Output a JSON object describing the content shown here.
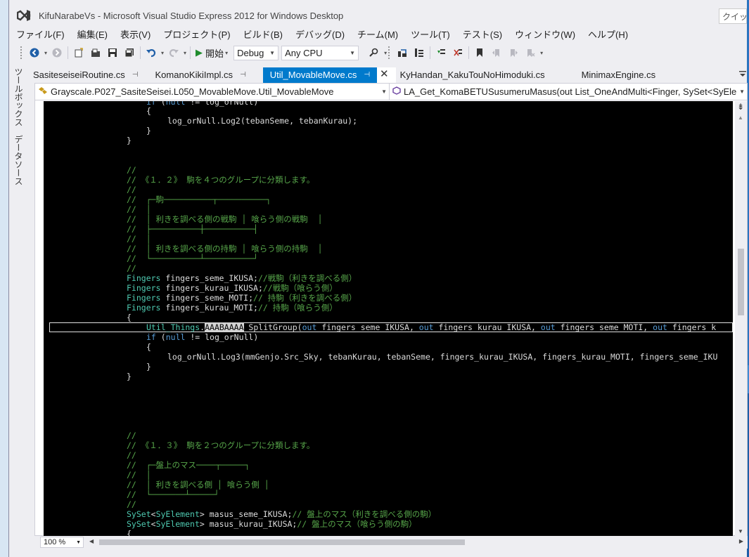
{
  "window": {
    "title": "KifuNarabeVs - Microsoft Visual Studio Express 2012 for Windows Desktop",
    "quick_launch": "クイッ"
  },
  "menu": [
    "ファイル(F)",
    "編集(E)",
    "表示(V)",
    "プロジェクト(P)",
    "ビルド(B)",
    "デバッグ(D)",
    "チーム(M)",
    "ツール(T)",
    "テスト(S)",
    "ウィンドウ(W)",
    "ヘルプ(H)"
  ],
  "toolbar": {
    "start_label": "開始",
    "config": "Debug",
    "platform": "Any CPU"
  },
  "tabs": [
    {
      "label": "SasiteseiseiRoutine.cs"
    },
    {
      "label": "KomanoKikiImpl.cs"
    },
    {
      "label": "Util_MovableMove.cs"
    },
    {
      "label": "KyHandan_KakuTouNoHimoduki.cs"
    },
    {
      "label": "MinimaxEngine.cs"
    }
  ],
  "sidebar": {
    "toolbox": "ツールボックス",
    "datasource": "データソース"
  },
  "navbar": {
    "type_path": "Grayscale.P027_SasiteSeisei.L050_MovableMove.Util_MovableMove",
    "member": "LA_Get_KomaBETUSusumeruMasus(out List_OneAndMulti<Finger, SySet<SyEle"
  },
  "code": {
    "l0": "if (null != log_orNull)",
    "l1": "{",
    "l2": "log_orNull.Log2(tebanSeme, tebanKurau);",
    "l3": "}",
    "l4": "}",
    "c1": "//",
    "c2": "// 《１．２》 駒を４つのグループに分類します。",
    "c3": "//",
    "c4": "//  ┌─駒──────────┬──────────┐",
    "c5": "//  │",
    "c6": "//  │ 利きを調べる側の戦駒 │ 喰らう側の戦駒  │",
    "c7": "//  ├──────────┼──────────┤",
    "c8": "//  │",
    "c9": "//  │ 利きを調べる側の持駒 │ 喰らう側の持駒  │",
    "c10": "//  └──────────┴──────────┘",
    "c11": "//",
    "d1_type": "Fingers",
    "d1_rest": " fingers_seme_IKUSA;",
    "d1_comment": "//戦駒（利きを調べる側）",
    "d2_type": "Fingers",
    "d2_rest": " fingers_kurau_IKUSA;",
    "d2_comment": "//戦駒（喰らう側）",
    "d3_type": "Fingers",
    "d3_rest": " fingers_seme_MOTI;",
    "d3_comment": "// 持駒（利きを調べる側）",
    "d4_type": "Fingers",
    "d4_rest": " fingers_kurau_MOTI;",
    "d4_comment": "// 持駒（喰らう側）",
    "brace_open": "{",
    "call_type": "Util_Things",
    "call_dot": ".",
    "call_sel": "AAABAAAA",
    "call_method": "_SplitGroup",
    "call_paren": "(",
    "call_out": "out",
    "call_a1": " fingers_seme_IKUSA, ",
    "call_a2": " fingers_kurau_IKUSA, ",
    "call_a3": " fingers_seme_MOTI, ",
    "call_a4": " fingers_k",
    "if_kw": "if",
    "if_open": " (",
    "if_null": "null",
    "if_rest": " != log_orNull)",
    "log3": "log_orNull.Log3(mmGenjo.Src_Sky, tebanKurau, tebanSeme, fingers_kurau_IKUSA, fingers_kurau_MOTI, fingers_seme_IKU",
    "e1": "//",
    "e2": "// 《１．３》 駒を２つのグループに分類します。",
    "e3": "//",
    "e4": "//  ┌─盤上のマス────┬─────┐",
    "e5": "//  │",
    "e6": "//  │ 利きを調べる側 │ 喰らう側 │",
    "e7": "//  └───────┴─────┘",
    "e8": "//",
    "s1_type": "SySet",
    "s1_lt": "<",
    "s1_gen": "SyElement",
    "s1_rest": "> masus_seme_IKUSA;",
    "s1_comment": "// 盤上のマス（利きを調べる側の駒）",
    "s2_type": "SySet",
    "s2_lt": "<",
    "s2_gen": "SyElement",
    "s2_rest": "> masus_kurau_IKUSA;",
    "s2_comment": "// 盤上のマス（喰らう側の駒）"
  },
  "zoom": "100 %",
  "colors": {
    "accent": "#007acc",
    "comment": "#57a64a",
    "keyword": "#569cd6",
    "type": "#4ec9b0",
    "editor_bg": "#000000",
    "chrome_bg": "#eeeef2"
  }
}
